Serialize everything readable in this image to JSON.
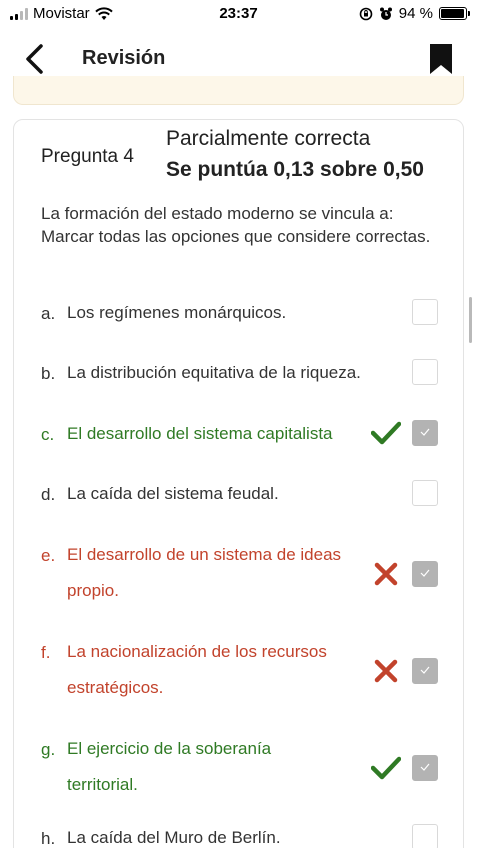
{
  "status_bar": {
    "carrier": "Movistar",
    "time": "23:37",
    "battery": "94 %",
    "battery_level": 0.94
  },
  "nav": {
    "title": "Revisión"
  },
  "question": {
    "number_label": "Pregunta 4",
    "status": "Parcialmente correcta",
    "score": "Se puntúa 0,13 sobre 0,50",
    "text": "La formación del estado moderno se vincula a: Marcar todas las opciones que considere correctas."
  },
  "options": [
    {
      "letter": "a.",
      "line1": "Los regímenes monárquicos.",
      "line2": "",
      "state": "default",
      "checked": false,
      "mark": "none"
    },
    {
      "letter": "b.",
      "line1": "La distribución equitativa de la riqueza.",
      "line2": "",
      "state": "default",
      "checked": false,
      "mark": "none"
    },
    {
      "letter": "c.",
      "line1": "El desarrollo del sistema capitalista",
      "line2": "",
      "state": "correct",
      "checked": true,
      "mark": "check-icon"
    },
    {
      "letter": "d.",
      "line1": "La caída del sistema feudal.",
      "line2": "",
      "state": "default",
      "checked": false,
      "mark": "none"
    },
    {
      "letter": "e.",
      "line1": "El desarrollo de un sistema de ideas",
      "line2": "propio.",
      "state": "wrong",
      "checked": true,
      "mark": "cross-icon"
    },
    {
      "letter": "f.",
      "line1": "La nacionalización de los recursos",
      "line2": "estratégicos.",
      "state": "wrong",
      "checked": true,
      "mark": "cross-icon"
    },
    {
      "letter": "g.",
      "line1": "El ejercicio de la soberanía",
      "line2": "territorial.",
      "state": "correct",
      "checked": true,
      "mark": "check-icon"
    },
    {
      "letter": "h.",
      "line1": "La caída del Muro de Berlín.",
      "line2": "",
      "state": "default",
      "checked": false,
      "mark": "none"
    }
  ],
  "colors": {
    "correct": "#2f7a24",
    "wrong": "#c2432c",
    "checkbox_checked": "#b3b3b3"
  }
}
